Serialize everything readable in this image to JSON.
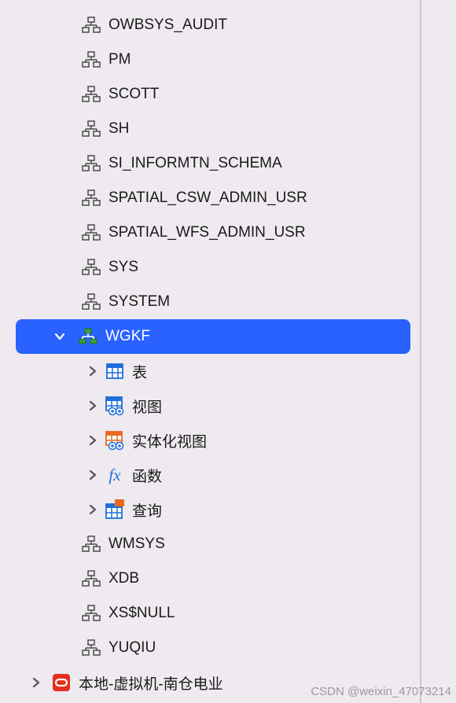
{
  "schemas": [
    {
      "label": "OWBSYS_AUDIT"
    },
    {
      "label": "PM"
    },
    {
      "label": "SCOTT"
    },
    {
      "label": "SH"
    },
    {
      "label": "SI_INFORMTN_SCHEMA"
    },
    {
      "label": "SPATIAL_CSW_ADMIN_USR"
    },
    {
      "label": "SPATIAL_WFS_ADMIN_USR"
    },
    {
      "label": "SYS"
    },
    {
      "label": "SYSTEM"
    }
  ],
  "selected_schema": {
    "label": "WGKF"
  },
  "children": [
    {
      "label": "表",
      "icon": "table-icon"
    },
    {
      "label": "视图",
      "icon": "view-icon"
    },
    {
      "label": "实体化视图",
      "icon": "materialized-view-icon"
    },
    {
      "label": "函数",
      "icon": "function-icon"
    },
    {
      "label": "查询",
      "icon": "query-icon"
    }
  ],
  "schemas_after": [
    {
      "label": "WMSYS"
    },
    {
      "label": "XDB"
    },
    {
      "label": "XS$NULL"
    },
    {
      "label": "YUQIU"
    }
  ],
  "connection": {
    "label": "本地-虚拟机-南仓电业"
  },
  "watermark": "CSDN @weixin_47073214"
}
